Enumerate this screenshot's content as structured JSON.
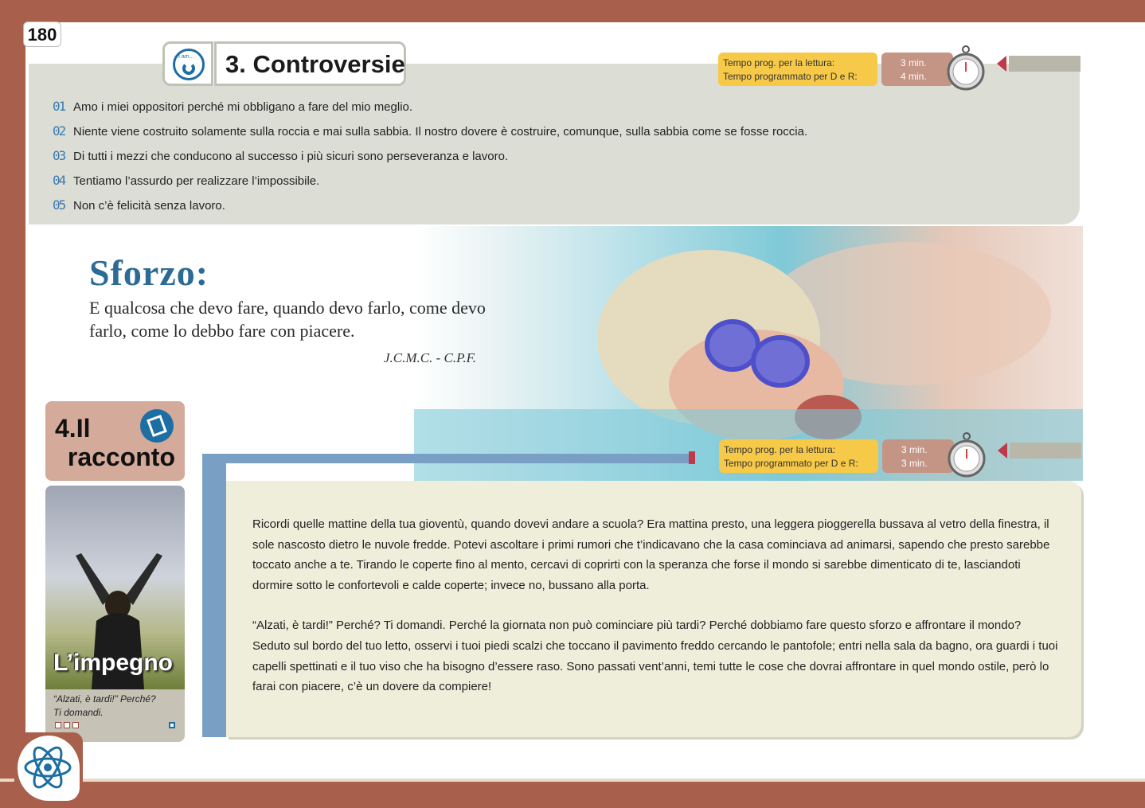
{
  "page_number": "180",
  "section3": {
    "title": "3. Controversie",
    "icon": "i-am-icon",
    "icon_label": "I am..."
  },
  "timer1": {
    "line1": "Tempo prog. per la lettura:",
    "line2": "Tempo programmato per D e R:",
    "min1": "3 min.",
    "min2": "4 min."
  },
  "quotes": [
    {
      "num": "01",
      "text": "Amo i miei oppositori perché mi obbligano a fare del mio meglio."
    },
    {
      "num": "02",
      "text": "Niente viene costruito solamente sulla roccia e mai sulla sabbia. Il nostro dovere è costruire, comunque, sulla sabbia come se fosse roccia."
    },
    {
      "num": "03",
      "text": "Di tutti i mezzi che conducono al successo i più sicuri sono perseveranza e lavoro."
    },
    {
      "num": "04",
      "text": "Tentiamo l’assurdo per realizzare l’impossibile."
    },
    {
      "num": "05",
      "text": "Non c’è felicità senza lavoro."
    }
  ],
  "sforzo": {
    "title": "Sforzo:",
    "text": "E qualcosa che devo fare, quando devo farlo, come devo farlo, come lo debbo fare con piacere.",
    "signature": "J.C.M.C. - C.P.F."
  },
  "section4": {
    "title_line1": "4.Il",
    "title_line2": "racconto"
  },
  "timer2": {
    "line1": "Tempo prog. per la lettura:",
    "line2": "Tempo programmato per D e R:",
    "min1": "3 min.",
    "min2": "3 min."
  },
  "card": {
    "title": "L’impegno",
    "caption1": "“Alzati, è tardi!” Perché?",
    "caption2": "Ti domandi."
  },
  "story": {
    "p1": "Ricordi quelle mattine della tua gioventù, quando dovevi andare a scuola? Era mattina presto, una leggera pioggerella bussava al vetro della finestra, il sole nascosto dietro le nuvole fredde. Potevi ascoltare i primi rumori che t’indicavano che la casa cominciava ad animarsi, sapendo che presto sarebbe toccato anche a te. Tirando le coperte fino al mento, cercavi di coprirti con la speranza che forse il mondo si sarebbe dimenticato di te, lasciandoti dormire sotto le confortevoli e calde coperte; invece no, bussano alla porta.",
    "p2": "“Alzati, è tardi!” Perché? Ti domandi. Perché la giornata non può cominciare più tardi? Perché dobbiamo fare questo sforzo e affrontare il mondo? Seduto sul bordo del tuo letto, osservi i tuoi piedi scalzi che toccano il pavimento freddo cercando le pantofole; entri nella sala da bagno, ora guardi i tuoi capelli spettinati e il tuo viso che ha bisogno d’essere raso. Sono passati vent’anni, temi tutte le cose che dovrai affrontare in quel mondo ostile, però lo farai con piacere, c’è un dovere da compiere!"
  },
  "colors": {
    "frame": "#a85f4c",
    "accent_blue": "#2b6b95",
    "timer_yellow": "#f7c948"
  }
}
